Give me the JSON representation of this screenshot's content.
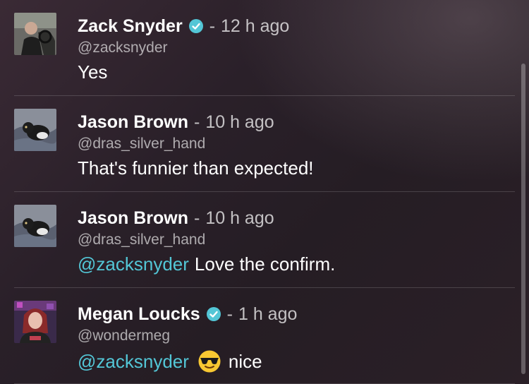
{
  "comments": [
    {
      "name": "Zack Snyder",
      "verified": true,
      "separator": "-",
      "time": "12 h ago",
      "handle": "@zacksnyder",
      "mention": "",
      "text": "Yes",
      "emoji": ""
    },
    {
      "name": "Jason Brown",
      "verified": false,
      "separator": "-",
      "time": "10 h ago",
      "handle": "@dras_silver_hand",
      "mention": "",
      "text": "That's funnier than expected!",
      "emoji": ""
    },
    {
      "name": "Jason Brown",
      "verified": false,
      "separator": "-",
      "time": "10 h ago",
      "handle": "@dras_silver_hand",
      "mention": "@zacksnyder",
      "text": "Love the confirm.",
      "emoji": ""
    },
    {
      "name": "Megan Loucks",
      "verified": true,
      "separator": "-",
      "time": "1 h ago",
      "handle": "@wondermeg",
      "mention": "@zacksnyder",
      "text": "nice",
      "emoji": "sunglasses-emoji"
    }
  ],
  "colors": {
    "mention": "#53c6d6",
    "verified_badge": "#53c6d6"
  },
  "icons": {
    "verified": "verified-check-icon"
  }
}
